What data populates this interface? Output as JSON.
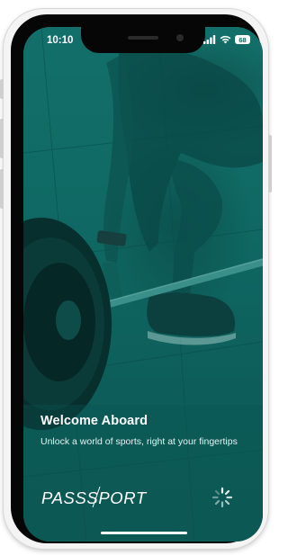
{
  "status_bar": {
    "time": "10:10",
    "battery": "68",
    "icons": [
      "signal-icon",
      "wifi-icon",
      "battery-icon"
    ]
  },
  "welcome": {
    "title": "Welcome Aboard",
    "subtitle": "Unlock a world of sports, right at your fingertips"
  },
  "brand": {
    "logo_text": "PASSSPORT",
    "accent_color": "#0f6863"
  },
  "loading": {
    "indicator": "spinner-icon"
  }
}
